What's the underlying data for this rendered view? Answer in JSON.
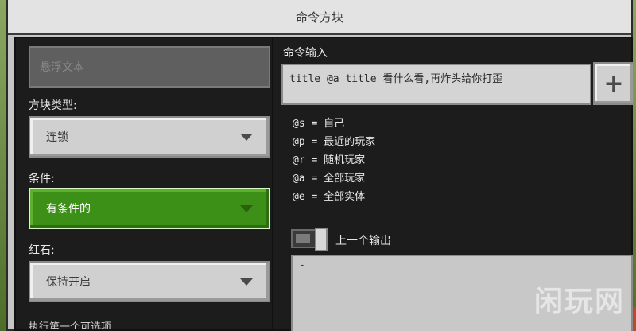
{
  "window": {
    "title": "命令方块"
  },
  "left": {
    "hover_text_placeholder": "悬浮文本",
    "block_type_label": "方块类型:",
    "block_type_value": "连锁",
    "condition_label": "条件:",
    "condition_value": "有条件的",
    "redstone_label": "红石:",
    "redstone_value": "保持开启",
    "partial_bottom": "执行第一个可选项"
  },
  "right": {
    "command_label": "命令输入",
    "command_value": "title @a title 看什么看,再炸头给你打歪",
    "plus_label": "+",
    "help": [
      "@s = 自己",
      "@p = 最近的玩家",
      "@r = 随机玩家",
      "@a = 全部玩家",
      "@e = 全部实体"
    ],
    "previous_output_label": "上一个输出",
    "output_value": "-"
  },
  "watermark": "闲玩网",
  "colors": {
    "condition_active": "#3c8f17",
    "panel_bg": "#1c1c1c",
    "button_bg": "#d0d0d0"
  }
}
